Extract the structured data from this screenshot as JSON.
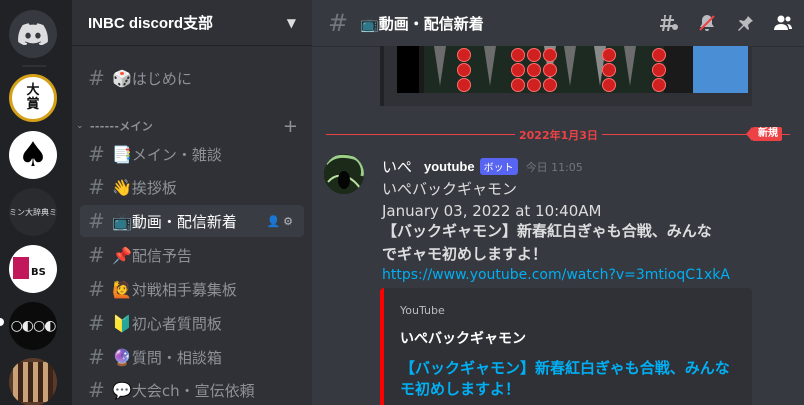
{
  "guild": {
    "name": "INBC discord支部"
  },
  "servers": [
    {
      "name": "home",
      "label": ""
    },
    {
      "name": "大賞",
      "label": "大\n賞"
    },
    {
      "name": "spade",
      "label": "♠"
    },
    {
      "name": "dictionary",
      "label": "ミン大辞典ミ"
    },
    {
      "name": "bs",
      "label": "BS"
    },
    {
      "name": "dots",
      "label": ""
    },
    {
      "name": "board",
      "label": ""
    }
  ],
  "category": {
    "name": "------メイン"
  },
  "channels": [
    {
      "emoji": "🎲",
      "label": "はじめに",
      "section": "top"
    },
    {
      "emoji": "📑",
      "label": "メイン・雑談"
    },
    {
      "emoji": "👋",
      "label": "挨拶板"
    },
    {
      "emoji": "📺",
      "label": "動画・配信新着",
      "selected": true
    },
    {
      "emoji": "📌",
      "label": "配信予告"
    },
    {
      "emoji": "🙋",
      "label": "対戦相手募集板"
    },
    {
      "emoji": "🔰",
      "label": "初心者質問板"
    },
    {
      "emoji": "🔮",
      "label": "質問・相談箱"
    },
    {
      "emoji": "💬",
      "label": "大会ch・宣伝依頼"
    }
  ],
  "header": {
    "channel": "📺動画・配信新着"
  },
  "divider": {
    "date": "2022年1月3日",
    "new_label": "新規"
  },
  "message": {
    "author": "いぺ",
    "author2": "youtube",
    "bot_tag": "ボット",
    "timestamp": "今日 11:05",
    "line1": "いぺバックギャモン",
    "line2": "January 03, 2022 at 10:40AM",
    "line3": "【バックギャモン】新春紅白ぎゃも合戦、みんな",
    "line4": "でギャモ初めしますよ！",
    "url": "https://www.youtube.com/watch?v=3mtioqC1xkA"
  },
  "embed": {
    "provider": "YouTube",
    "author": "いぺバックギャモン",
    "title": "【バックギャモン】新春紅白ぎゃも合戦、みんなモ初めしますよ！"
  },
  "colors": {
    "accent": "#ed4245",
    "link": "#00aff4",
    "bot": "#5865f2"
  }
}
